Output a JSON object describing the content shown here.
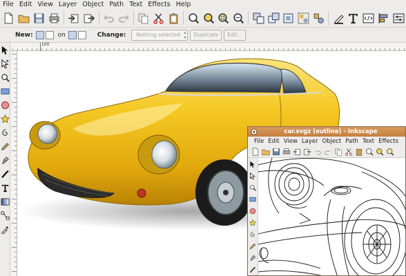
{
  "menubar": {
    "items": [
      "File",
      "Edit",
      "View",
      "Layer",
      "Object",
      "Path",
      "Text",
      "Effects",
      "Help"
    ]
  },
  "toolbar": {
    "icons": [
      "new-document-icon",
      "open-folder-icon",
      "save-icon",
      "print-icon",
      "import-icon",
      "export-icon",
      "undo-icon",
      "redo-icon",
      "copy-icon",
      "cut-icon",
      "paste-icon",
      "zoom-selection-icon",
      "zoom-drawing-icon",
      "zoom-page-icon",
      "duplicate-icon",
      "clone-icon",
      "unlink-clone-icon",
      "group-icon",
      "ungroup-icon",
      "fill-stroke-icon",
      "text-font-icon",
      "xml-editor-icon",
      "align-icon",
      "preferences-icon"
    ]
  },
  "controls": {
    "new_label": "New:",
    "on_label": "on",
    "change_label": "Change:",
    "selection_placeholder": "Nothing selected",
    "duplicate_label": "Duplicate",
    "edit_label": "Edit..."
  },
  "ruler": {
    "labels": [
      "100",
      "",
      "",
      "",
      "",
      "",
      "",
      "",
      "",
      "",
      "",
      ""
    ]
  },
  "tools": [
    "selector-icon",
    "node-editor-icon",
    "zoom-icon",
    "rectangle-icon",
    "ellipse-icon",
    "star-icon",
    "spiral-icon",
    "pencil-icon",
    "pen-icon",
    "calligraphy-icon",
    "text-icon",
    "gradient-icon",
    "connector-icon",
    "dropper-icon"
  ],
  "window2": {
    "title": "car.svgz (outline) - Inkscape",
    "menu": [
      "File",
      "Edit",
      "View",
      "Layer",
      "Object",
      "Path",
      "Text",
      "Effects"
    ]
  },
  "colors": {
    "car_yellow": "#f2c21a",
    "titlebar_orange": "#c98545"
  }
}
